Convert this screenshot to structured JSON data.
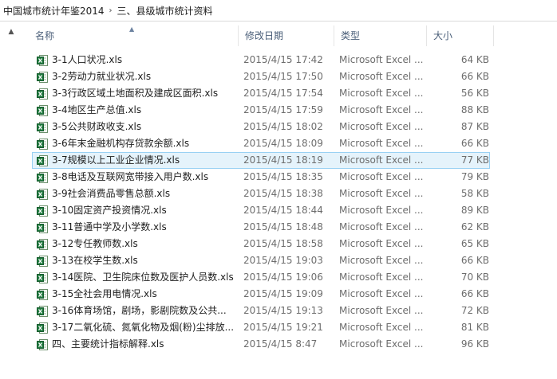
{
  "breadcrumb": [
    "中国城市统计年鉴2014",
    "三、县级城市统计资料"
  ],
  "columns": {
    "name": "名称",
    "date": "修改日期",
    "type": "类型",
    "size": "大小"
  },
  "icons": {
    "file": "excel-file-icon",
    "scroll_up": "chevron-up-icon",
    "sort": "sort-ascending-icon"
  },
  "files": [
    {
      "name": "3-1人口状况.xls",
      "date": "2015/4/15 17:42",
      "type": "Microsoft Excel ...",
      "size": "64 KB",
      "selected": false
    },
    {
      "name": "3-2劳动力就业状况.xls",
      "date": "2015/4/15 17:50",
      "type": "Microsoft Excel ...",
      "size": "66 KB",
      "selected": false
    },
    {
      "name": "3-3行政区域土地面积及建成区面积.xls",
      "date": "2015/4/15 17:54",
      "type": "Microsoft Excel ...",
      "size": "56 KB",
      "selected": false
    },
    {
      "name": "3-4地区生产总值.xls",
      "date": "2015/4/15 17:59",
      "type": "Microsoft Excel ...",
      "size": "88 KB",
      "selected": false
    },
    {
      "name": "3-5公共财政收支.xls",
      "date": "2015/4/15 18:02",
      "type": "Microsoft Excel ...",
      "size": "87 KB",
      "selected": false
    },
    {
      "name": "3-6年末金融机构存贷款余额.xls",
      "date": "2015/4/15 18:09",
      "type": "Microsoft Excel ...",
      "size": "66 KB",
      "selected": false
    },
    {
      "name": "3-7规模以上工业企业情况.xls",
      "date": "2015/4/15 18:19",
      "type": "Microsoft Excel ...",
      "size": "77 KB",
      "selected": true
    },
    {
      "name": "3-8电话及互联网宽带接入用户数.xls",
      "date": "2015/4/15 18:35",
      "type": "Microsoft Excel ...",
      "size": "79 KB",
      "selected": false
    },
    {
      "name": "3-9社会消费品零售总额.xls",
      "date": "2015/4/15 18:38",
      "type": "Microsoft Excel ...",
      "size": "58 KB",
      "selected": false
    },
    {
      "name": "3-10固定资产投资情况.xls",
      "date": "2015/4/15 18:44",
      "type": "Microsoft Excel ...",
      "size": "89 KB",
      "selected": false
    },
    {
      "name": "3-11普通中学及小学数.xls",
      "date": "2015/4/15 18:48",
      "type": "Microsoft Excel ...",
      "size": "62 KB",
      "selected": false
    },
    {
      "name": "3-12专任教师数.xls",
      "date": "2015/4/15 18:58",
      "type": "Microsoft Excel ...",
      "size": "65 KB",
      "selected": false
    },
    {
      "name": "3-13在校学生数.xls",
      "date": "2015/4/15 19:03",
      "type": "Microsoft Excel ...",
      "size": "66 KB",
      "selected": false
    },
    {
      "name": "3-14医院、卫生院床位数及医护人员数.xls",
      "date": "2015/4/15 19:06",
      "type": "Microsoft Excel ...",
      "size": "70 KB",
      "selected": false
    },
    {
      "name": "3-15全社会用电情况.xls",
      "date": "2015/4/15 19:09",
      "type": "Microsoft Excel ...",
      "size": "66 KB",
      "selected": false
    },
    {
      "name": "3-16体育场馆，剧场，影剧院数及公共...",
      "date": "2015/4/15 19:13",
      "type": "Microsoft Excel ...",
      "size": "72 KB",
      "selected": false
    },
    {
      "name": "3-17二氧化硫、氮氧化物及烟(粉)尘排放...",
      "date": "2015/4/15 19:21",
      "type": "Microsoft Excel ...",
      "size": "81 KB",
      "selected": false
    },
    {
      "name": "四、主要统计指标解释.xls",
      "date": "2015/4/15 8:47",
      "type": "Microsoft Excel ...",
      "size": "96 KB",
      "selected": false
    }
  ]
}
